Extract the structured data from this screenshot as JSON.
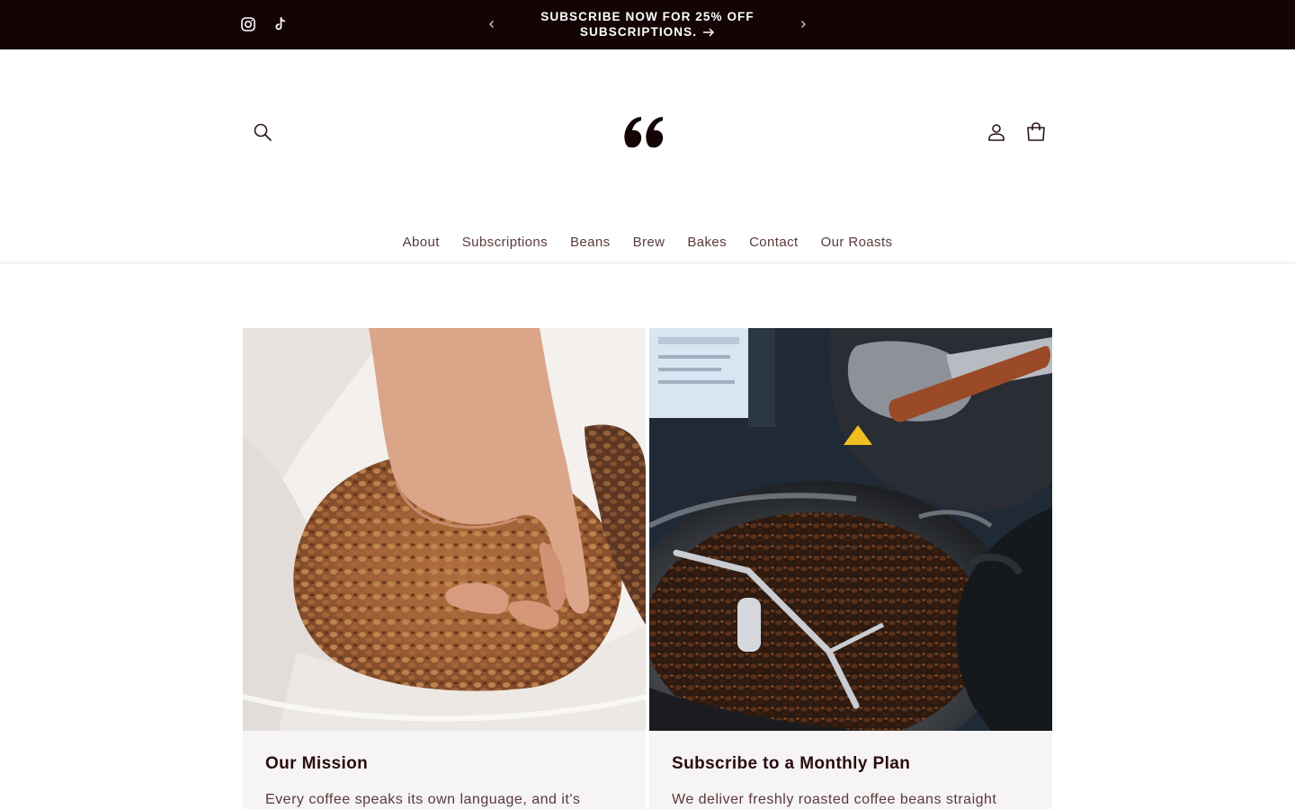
{
  "announcement": {
    "line1": "SUBSCRIBE NOW FOR 25% OFF",
    "line2": "SUBSCRIPTIONS.",
    "social": [
      {
        "name": "instagram-icon"
      },
      {
        "name": "tiktok-icon"
      }
    ]
  },
  "header": {
    "logo_icon": "quote-mark-logo",
    "icons": [
      "search-icon",
      "account-icon",
      "cart-icon"
    ]
  },
  "nav": {
    "items": [
      {
        "label": "About"
      },
      {
        "label": "Subscriptions"
      },
      {
        "label": "Beans"
      },
      {
        "label": "Brew"
      },
      {
        "label": "Bakes"
      },
      {
        "label": "Contact"
      },
      {
        "label": "Our Roasts"
      }
    ]
  },
  "cards": [
    {
      "title": "Our Mission",
      "text": "Every coffee speaks its own language, and it's",
      "image": "hand-scooping-green-coffee-beans"
    },
    {
      "title": "Subscribe to a Monthly Plan",
      "text": "We deliver freshly roasted coffee beans straight",
      "image": "coffee-roaster-drum-with-beans"
    }
  ],
  "colors": {
    "announcement_bg": "#140406",
    "text_dark": "#2a0c10",
    "text_muted": "#5a3a3c",
    "card_bg": "#f6f4f4"
  }
}
